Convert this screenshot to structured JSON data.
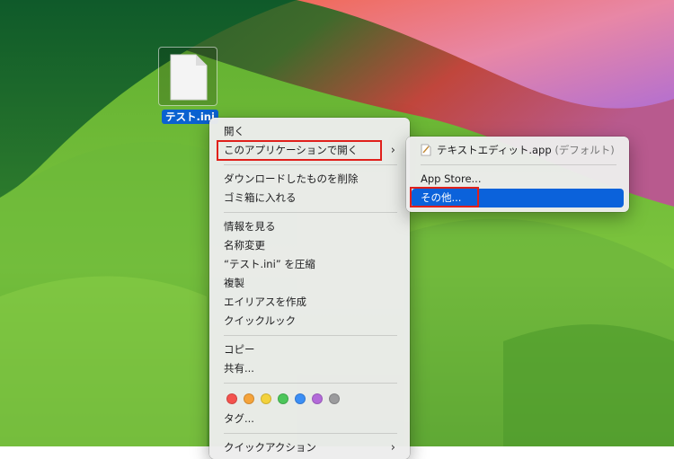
{
  "colors": {
    "selection": "#0b62db",
    "highlight_box": "#e0201b",
    "menu_bg": "#ececec"
  },
  "desktop": {
    "file": {
      "name": "テスト.ini",
      "icon": "document-icon"
    }
  },
  "context_menu": {
    "items": [
      {
        "label": "開く"
      },
      {
        "label": "このアプリケーションで開く",
        "has_submenu": true
      }
    ],
    "group2": [
      {
        "label": "ダウンロードしたものを削除"
      },
      {
        "label": "ゴミ箱に入れる"
      }
    ],
    "group3": [
      {
        "label": "情報を見る"
      },
      {
        "label": "名称変更"
      },
      {
        "label": "“テスト.ini” を圧縮"
      },
      {
        "label": "複製"
      },
      {
        "label": "エイリアスを作成"
      },
      {
        "label": "クイックルック"
      }
    ],
    "group4": [
      {
        "label": "コピー"
      },
      {
        "label": "共有..."
      }
    ],
    "tag_colors": [
      {
        "name": "red",
        "color": "#f4524d"
      },
      {
        "name": "orange",
        "color": "#f5a33a"
      },
      {
        "name": "yellow",
        "color": "#f3d23c"
      },
      {
        "name": "green",
        "color": "#4cc65a"
      },
      {
        "name": "blue",
        "color": "#3b8ef5"
      },
      {
        "name": "purple",
        "color": "#b36ad9"
      },
      {
        "name": "gray",
        "color": "#9b9b9d"
      }
    ],
    "tags_label": "タグ...",
    "quick_actions": {
      "label": "クイックアクション",
      "has_submenu": true
    }
  },
  "open_with_submenu": {
    "default_app": {
      "label": "テキストエディット.app",
      "suffix": "(デフォルト)",
      "icon": "textedit-icon"
    },
    "app_store": {
      "label": "App Store..."
    },
    "other": {
      "label": "その他...",
      "selected": true
    }
  }
}
